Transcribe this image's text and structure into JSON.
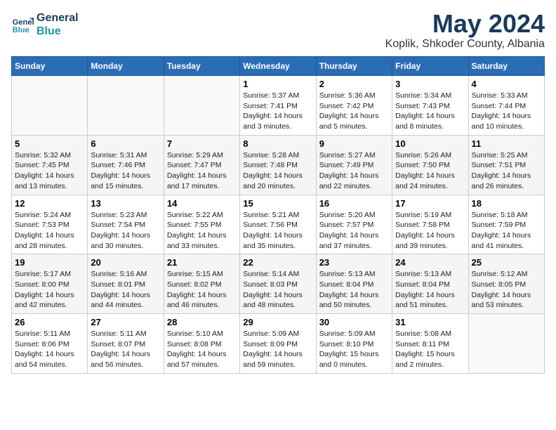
{
  "logo": {
    "line1": "General",
    "line2": "Blue"
  },
  "title": "May 2024",
  "subtitle": "Koplik, Shkoder County, Albania",
  "days_header": [
    "Sunday",
    "Monday",
    "Tuesday",
    "Wednesday",
    "Thursday",
    "Friday",
    "Saturday"
  ],
  "weeks": [
    [
      {
        "day": "",
        "info": ""
      },
      {
        "day": "",
        "info": ""
      },
      {
        "day": "",
        "info": ""
      },
      {
        "day": "1",
        "info": "Sunrise: 5:37 AM\nSunset: 7:41 PM\nDaylight: 14 hours\nand 3 minutes."
      },
      {
        "day": "2",
        "info": "Sunrise: 5:36 AM\nSunset: 7:42 PM\nDaylight: 14 hours\nand 5 minutes."
      },
      {
        "day": "3",
        "info": "Sunrise: 5:34 AM\nSunset: 7:43 PM\nDaylight: 14 hours\nand 8 minutes."
      },
      {
        "day": "4",
        "info": "Sunrise: 5:33 AM\nSunset: 7:44 PM\nDaylight: 14 hours\nand 10 minutes."
      }
    ],
    [
      {
        "day": "5",
        "info": "Sunrise: 5:32 AM\nSunset: 7:45 PM\nDaylight: 14 hours\nand 13 minutes."
      },
      {
        "day": "6",
        "info": "Sunrise: 5:31 AM\nSunset: 7:46 PM\nDaylight: 14 hours\nand 15 minutes."
      },
      {
        "day": "7",
        "info": "Sunrise: 5:29 AM\nSunset: 7:47 PM\nDaylight: 14 hours\nand 17 minutes."
      },
      {
        "day": "8",
        "info": "Sunrise: 5:28 AM\nSunset: 7:48 PM\nDaylight: 14 hours\nand 20 minutes."
      },
      {
        "day": "9",
        "info": "Sunrise: 5:27 AM\nSunset: 7:49 PM\nDaylight: 14 hours\nand 22 minutes."
      },
      {
        "day": "10",
        "info": "Sunrise: 5:26 AM\nSunset: 7:50 PM\nDaylight: 14 hours\nand 24 minutes."
      },
      {
        "day": "11",
        "info": "Sunrise: 5:25 AM\nSunset: 7:51 PM\nDaylight: 14 hours\nand 26 minutes."
      }
    ],
    [
      {
        "day": "12",
        "info": "Sunrise: 5:24 AM\nSunset: 7:53 PM\nDaylight: 14 hours\nand 28 minutes."
      },
      {
        "day": "13",
        "info": "Sunrise: 5:23 AM\nSunset: 7:54 PM\nDaylight: 14 hours\nand 30 minutes."
      },
      {
        "day": "14",
        "info": "Sunrise: 5:22 AM\nSunset: 7:55 PM\nDaylight: 14 hours\nand 33 minutes."
      },
      {
        "day": "15",
        "info": "Sunrise: 5:21 AM\nSunset: 7:56 PM\nDaylight: 14 hours\nand 35 minutes."
      },
      {
        "day": "16",
        "info": "Sunrise: 5:20 AM\nSunset: 7:57 PM\nDaylight: 14 hours\nand 37 minutes."
      },
      {
        "day": "17",
        "info": "Sunrise: 5:19 AM\nSunset: 7:58 PM\nDaylight: 14 hours\nand 39 minutes."
      },
      {
        "day": "18",
        "info": "Sunrise: 5:18 AM\nSunset: 7:59 PM\nDaylight: 14 hours\nand 41 minutes."
      }
    ],
    [
      {
        "day": "19",
        "info": "Sunrise: 5:17 AM\nSunset: 8:00 PM\nDaylight: 14 hours\nand 42 minutes."
      },
      {
        "day": "20",
        "info": "Sunrise: 5:16 AM\nSunset: 8:01 PM\nDaylight: 14 hours\nand 44 minutes."
      },
      {
        "day": "21",
        "info": "Sunrise: 5:15 AM\nSunset: 8:02 PM\nDaylight: 14 hours\nand 46 minutes."
      },
      {
        "day": "22",
        "info": "Sunrise: 5:14 AM\nSunset: 8:03 PM\nDaylight: 14 hours\nand 48 minutes."
      },
      {
        "day": "23",
        "info": "Sunrise: 5:13 AM\nSunset: 8:04 PM\nDaylight: 14 hours\nand 50 minutes."
      },
      {
        "day": "24",
        "info": "Sunrise: 5:13 AM\nSunset: 8:04 PM\nDaylight: 14 hours\nand 51 minutes."
      },
      {
        "day": "25",
        "info": "Sunrise: 5:12 AM\nSunset: 8:05 PM\nDaylight: 14 hours\nand 53 minutes."
      }
    ],
    [
      {
        "day": "26",
        "info": "Sunrise: 5:11 AM\nSunset: 8:06 PM\nDaylight: 14 hours\nand 54 minutes."
      },
      {
        "day": "27",
        "info": "Sunrise: 5:11 AM\nSunset: 8:07 PM\nDaylight: 14 hours\nand 56 minutes."
      },
      {
        "day": "28",
        "info": "Sunrise: 5:10 AM\nSunset: 8:08 PM\nDaylight: 14 hours\nand 57 minutes."
      },
      {
        "day": "29",
        "info": "Sunrise: 5:09 AM\nSunset: 8:09 PM\nDaylight: 14 hours\nand 59 minutes."
      },
      {
        "day": "30",
        "info": "Sunrise: 5:09 AM\nSunset: 8:10 PM\nDaylight: 15 hours\nand 0 minutes."
      },
      {
        "day": "31",
        "info": "Sunrise: 5:08 AM\nSunset: 8:11 PM\nDaylight: 15 hours\nand 2 minutes."
      },
      {
        "day": "",
        "info": ""
      }
    ]
  ]
}
